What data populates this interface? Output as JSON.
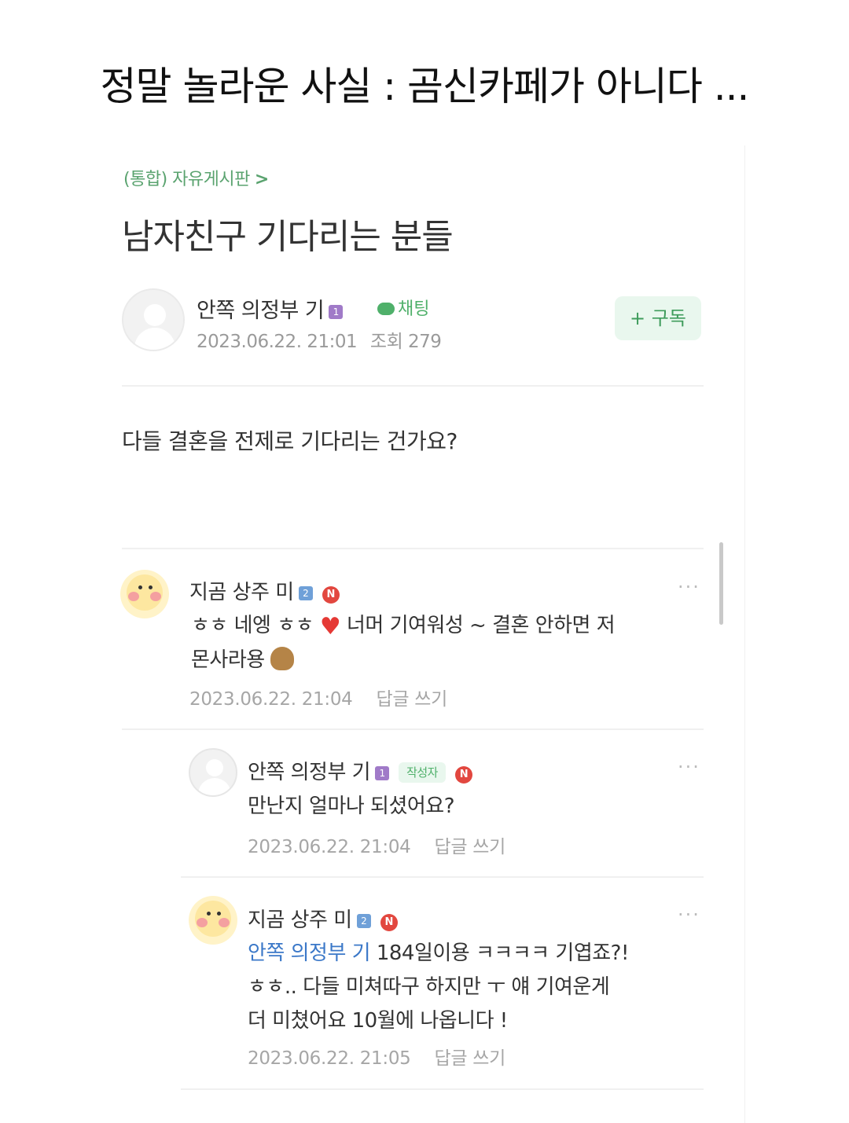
{
  "headline": "정말 놀라운 사실 : 곰신카페가 아니다 ...",
  "post": {
    "breadcrumb": "(통합) 자유게시판",
    "breadcrumb_chevron": ">",
    "title": "남자친구 기다리는 분들",
    "author": {
      "name": "안쪽 의정부 기",
      "level_badge": "1",
      "chat_label": "채팅",
      "date": "2023.06.22. 21:01",
      "views": "조회 279"
    },
    "subscribe_label": "+ 구독",
    "body": "다들 결혼을 전제로 기다리는 건가요?"
  },
  "comments": [
    {
      "name": "지곰 상주 미",
      "level_badge": "2",
      "badge_n": "N",
      "text_line1_a": "ㅎㅎ 네엥 ㅎㅎ",
      "text_line1_b": "너머 기여워성 ~ 결혼 안하면 저",
      "text_line2": "몬사라용",
      "date": "2023.06.22. 21:04",
      "reply_label": "답글 쓰기",
      "more": "···"
    },
    {
      "name": "안쪽 의정부 기",
      "level_badge": "1",
      "writer_tag": "작성자",
      "badge_n": "N",
      "text": "만난지 얼마나 되셨어요?",
      "date": "2023.06.22. 21:04",
      "reply_label": "답글 쓰기",
      "more": "···"
    },
    {
      "name": "지곰 상주 미",
      "level_badge": "2",
      "badge_n": "N",
      "mention": "안쪽 의정부 기",
      "text_line1": " 184일이용 ㅋㅋㅋㅋ 기엽죠?!",
      "text_line2": "ㅎㅎ.. 다들 미쳐따구 하지만 ㅜ 얘 기여운게",
      "text_line3": "더 미쳤어요 10월에 나옵니다 !",
      "date": "2023.06.22. 21:05",
      "reply_label": "답글 쓰기",
      "more": "···"
    }
  ],
  "colors": {
    "accent_green": "#4fb06a",
    "mention_blue": "#3b78c8",
    "badge_red": "#e2473f"
  }
}
